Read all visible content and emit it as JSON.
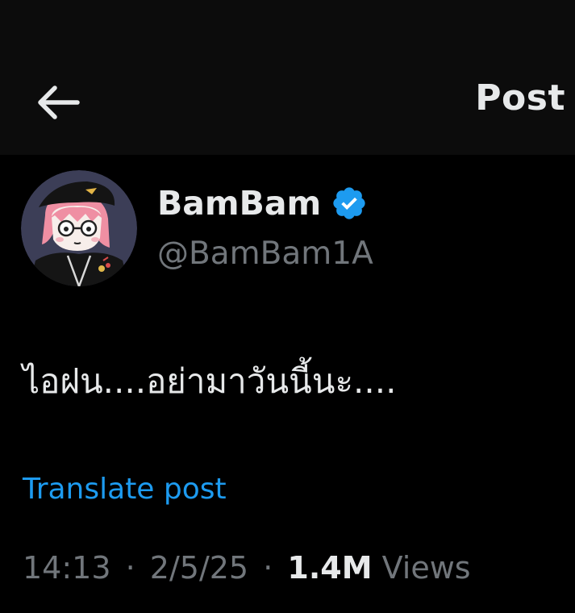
{
  "header": {
    "back_icon": "arrow-left-icon",
    "title": "Post"
  },
  "author": {
    "display_name": "BamBam",
    "verified_icon": "verified-badge-icon",
    "verified_color": "#1d9bf0",
    "handle": "@BamBam1A",
    "avatar": "avatar"
  },
  "post": {
    "text": "ไอฝน....อย่ามาวันนี้นะ....",
    "translate_label": "Translate post"
  },
  "meta": {
    "time": "14:13",
    "separator": "·",
    "date": "2/5/25",
    "views_count": "1.4M",
    "views_label": "Views"
  },
  "colors": {
    "background": "#000000",
    "header_background": "#0c0c0c",
    "primary_text": "#e7e9ea",
    "secondary_text": "#71767b",
    "link": "#1d9bf0"
  }
}
